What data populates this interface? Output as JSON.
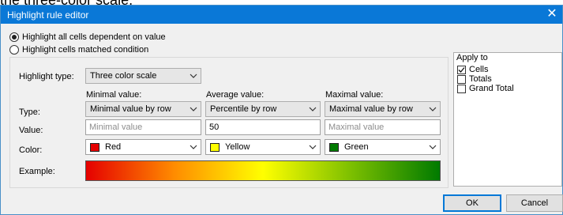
{
  "caption_fragment": "the three-color scale.",
  "window": {
    "title": "Highlight rule editor",
    "close_glyph": "✕"
  },
  "mode": {
    "options": [
      {
        "label": "Highlight all cells dependent on value",
        "selected": true
      },
      {
        "label": "Highlight cells matched condition",
        "selected": false
      }
    ]
  },
  "highlight_type": {
    "label": "Highlight type:",
    "value": "Three color scale"
  },
  "columns": [
    {
      "header": "Minimal value:",
      "type": "Minimal value by row",
      "value": "",
      "placeholder": "Minimal value",
      "color_name": "Red",
      "color": "#e50000"
    },
    {
      "header": "Average value:",
      "type": "Percentile by row",
      "value": "50",
      "placeholder": "",
      "color_name": "Yellow",
      "color": "#ffff00"
    },
    {
      "header": "Maximal value:",
      "type": "Maximal value by row",
      "value": "",
      "placeholder": "Maximal value",
      "color_name": "Green",
      "color": "#007a00"
    }
  ],
  "row_labels": {
    "type": "Type:",
    "value": "Value:",
    "color": "Color:",
    "example": "Example:"
  },
  "apply_to": {
    "title": "Apply to",
    "items": [
      {
        "label": "Cells",
        "checked": true
      },
      {
        "label": "Totals",
        "checked": false
      },
      {
        "label": "Grand Total",
        "checked": false
      }
    ]
  },
  "buttons": {
    "ok": "OK",
    "cancel": "Cancel"
  },
  "icons": {
    "dropdown": "chevron-down-icon",
    "check": "checkmark-icon",
    "close": "close-icon"
  }
}
